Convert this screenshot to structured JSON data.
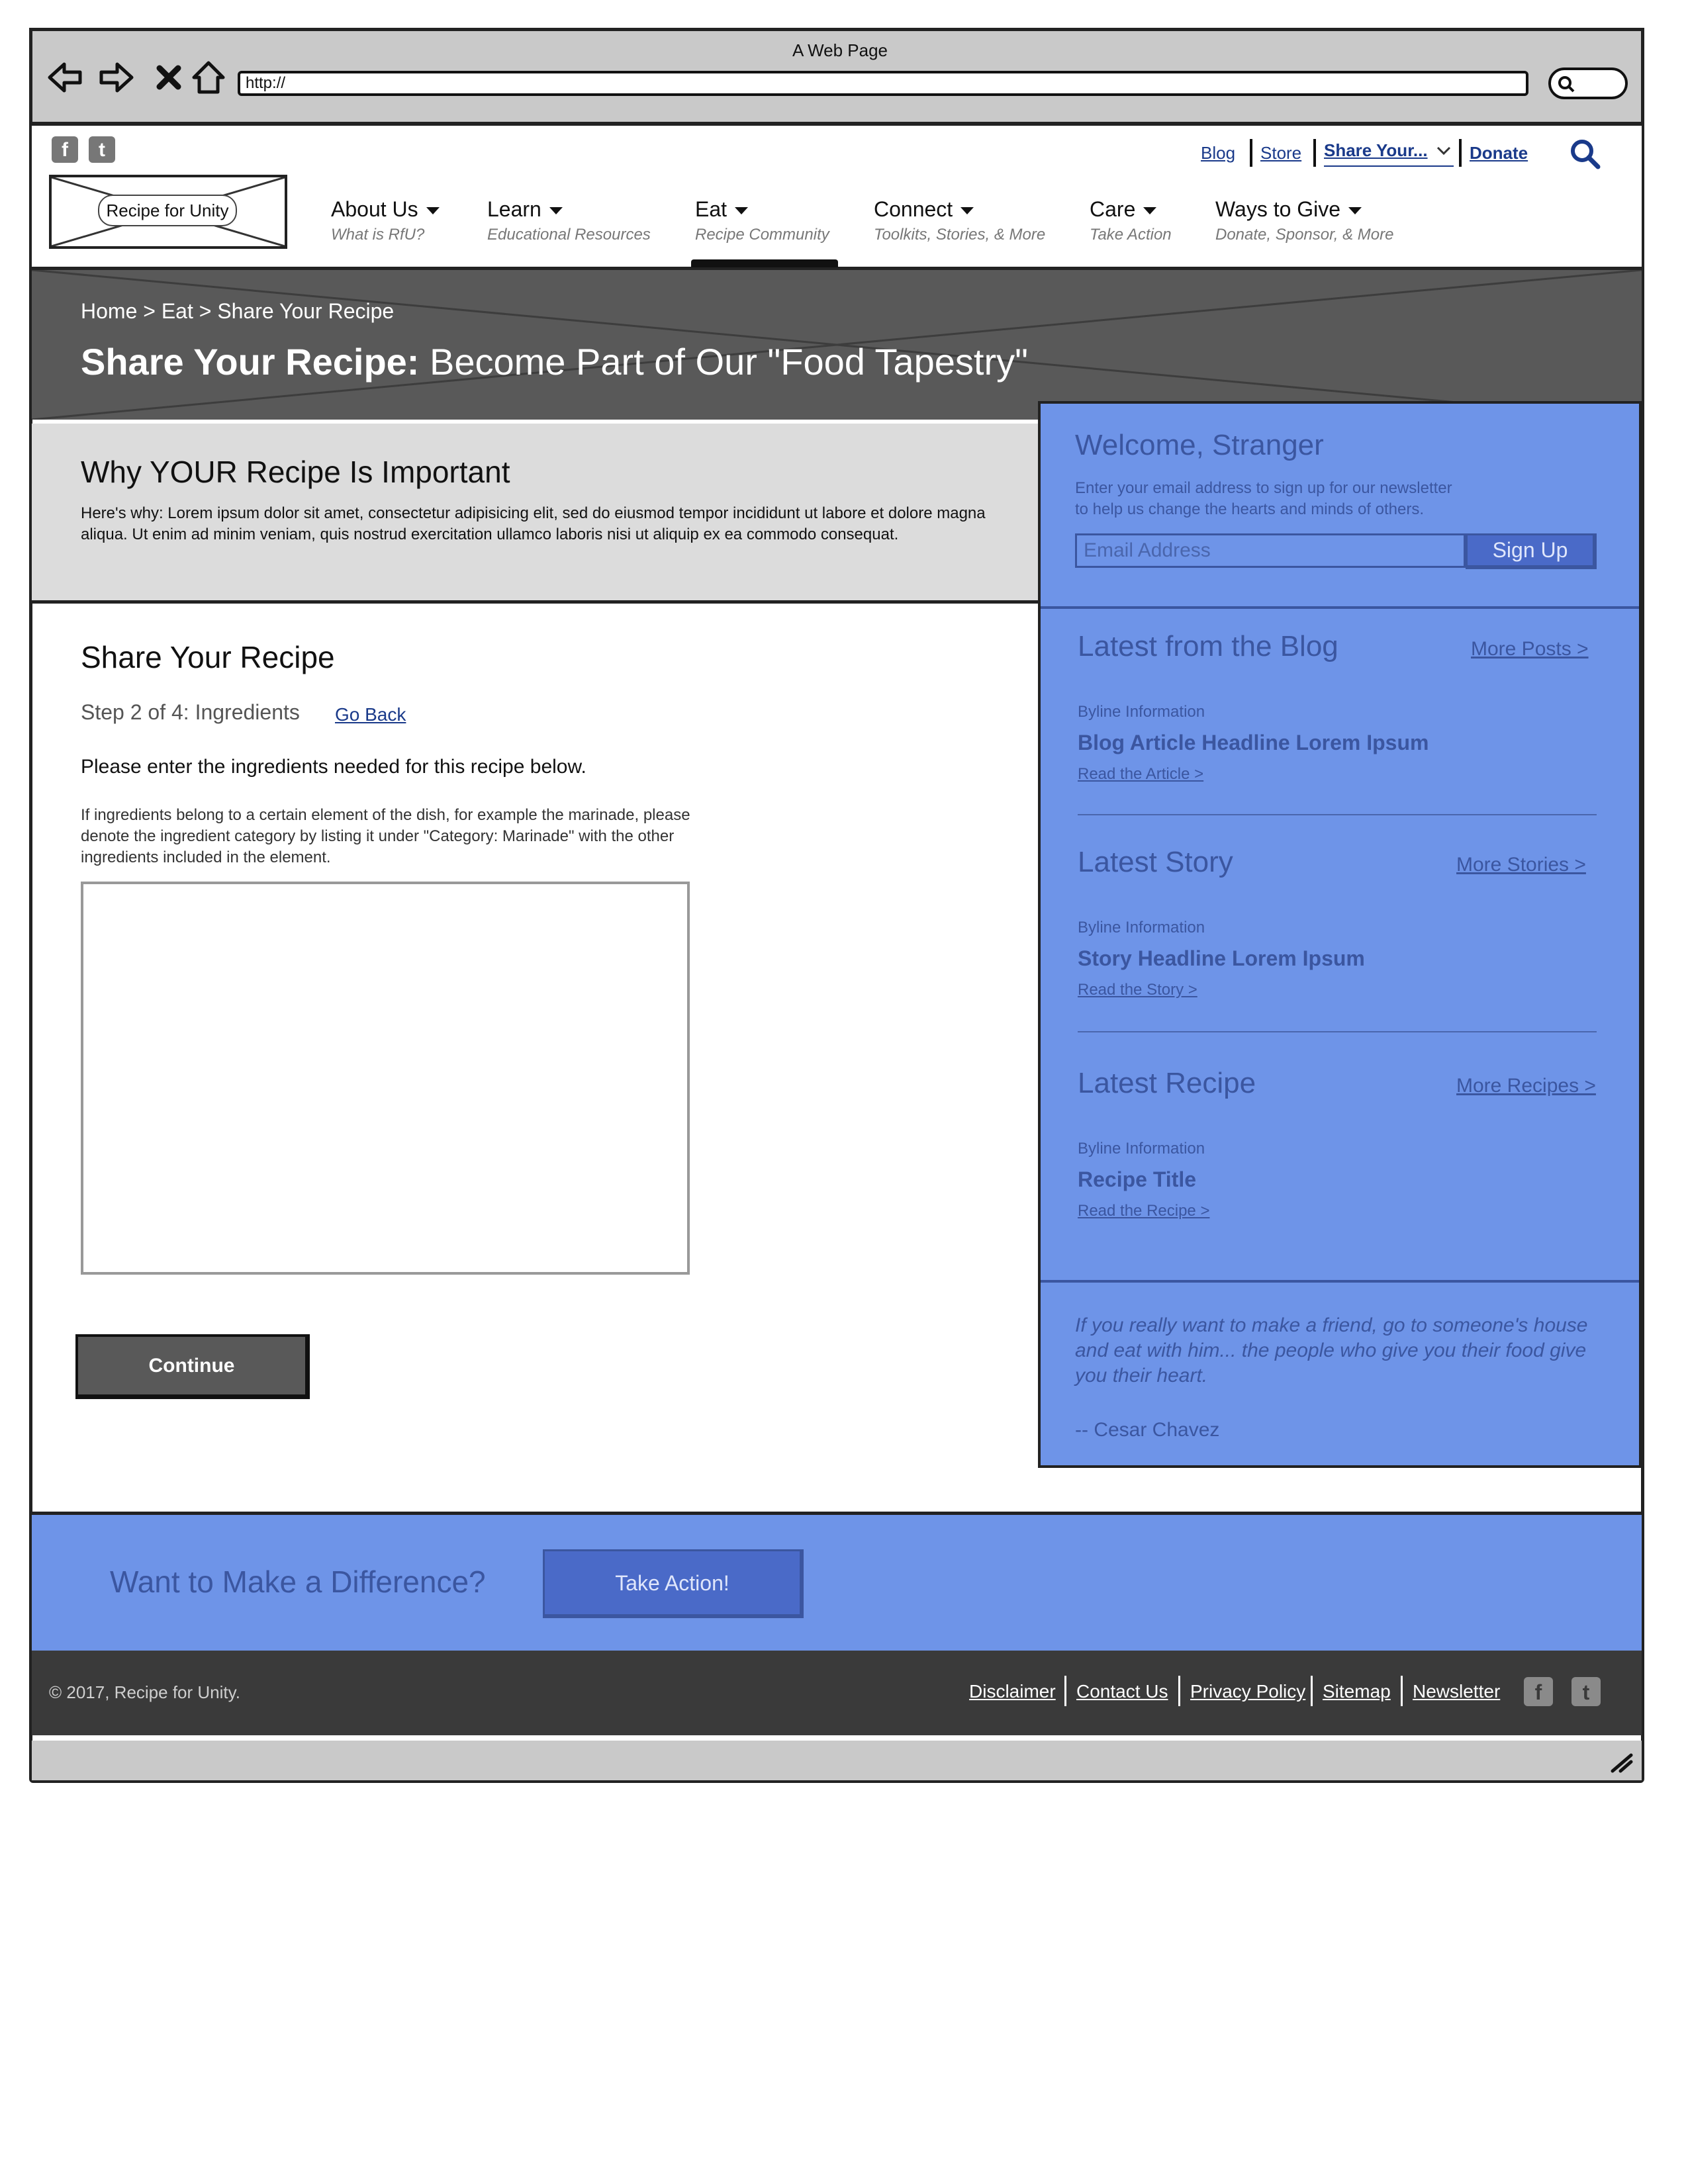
{
  "browser": {
    "window_title": "A Web Page",
    "url": "http://"
  },
  "header": {
    "logo_text": "Recipe for Unity",
    "social": [
      "facebook-icon",
      "twitter-icon"
    ],
    "utility_links": {
      "blog": "Blog",
      "store": "Store",
      "share": "Share Your...",
      "donate": "Donate"
    },
    "nav": [
      {
        "label": "About Us",
        "sub": "What is RfU?"
      },
      {
        "label": "Learn",
        "sub": "Educational Resources"
      },
      {
        "label": "Eat",
        "sub": "Recipe Community"
      },
      {
        "label": "Connect",
        "sub": "Toolkits, Stories, & More"
      },
      {
        "label": "Care",
        "sub": "Take Action"
      },
      {
        "label": "Ways to Give",
        "sub": "Donate, Sponsor, & More"
      }
    ],
    "active_nav": "Eat"
  },
  "hero": {
    "breadcrumb": "Home > Eat > Share Your Recipe",
    "title_bold": "Share Your Recipe:",
    "title_rest": " Become Part of Our \"Food Tapestry\""
  },
  "intro": {
    "title": "Why YOUR Recipe Is Important",
    "text": "Here's why: Lorem ipsum dolor sit amet, consectetur adipisicing elit, sed do eiusmod tempor incididunt ut labore et dolore magna aliqua. Ut enim ad minim veniam, quis nostrud exercitation ullamco laboris nisi ut aliquip ex ea commodo consequat."
  },
  "form": {
    "title": "Share Your Recipe",
    "step": "Step 2 of 4: Ingredients",
    "go_back": "Go Back",
    "instruction": "Please enter the ingredients needed for this recipe below.",
    "hint": "If ingredients belong to a certain element of the dish, for example the marinade, please denote the ingredient category by listing it under \"Category: Marinade\" with the other ingredients included in the element.",
    "ingredients_value": "",
    "continue": "Continue"
  },
  "sidebar": {
    "welcome_title": "Welcome, Stranger",
    "welcome_text_1": "Enter your email address to sign up for our newsletter",
    "welcome_text_2": "to help us change the hearts and minds of others.",
    "email_placeholder": "Email Address",
    "signup": "Sign Up",
    "blog": {
      "title": "Latest from the Blog",
      "more": "More Posts >",
      "byline": "Byline Information",
      "headline": "Blog Article Headline Lorem Ipsum",
      "read": "Read the Article >"
    },
    "story": {
      "title": "Latest Story",
      "more": "More Stories >",
      "byline": "Byline Information",
      "headline": "Story Headline Lorem Ipsum",
      "read": "Read the Story >"
    },
    "recipe": {
      "title": "Latest Recipe",
      "more": "More Recipes >",
      "byline": "Byline Information",
      "headline": "Recipe Title",
      "read": "Read the Recipe >"
    },
    "quote": "If you really want to make a friend, go to someone's house and eat with him... the people who give you their food give you their heart.",
    "quote_author": "-- Cesar Chavez"
  },
  "cta": {
    "text": "Want to Make a Difference?",
    "button": "Take Action!"
  },
  "footer": {
    "copyright": "© 2017, Recipe for Unity.",
    "links": [
      "Disclaimer",
      "Contact Us",
      "Privacy Policy",
      "Sitemap",
      "Newsletter"
    ]
  },
  "colors": {
    "sidebar_blue": "#6e94e8",
    "button_dark": "#595959",
    "footer_dark": "#3a3a3a"
  }
}
